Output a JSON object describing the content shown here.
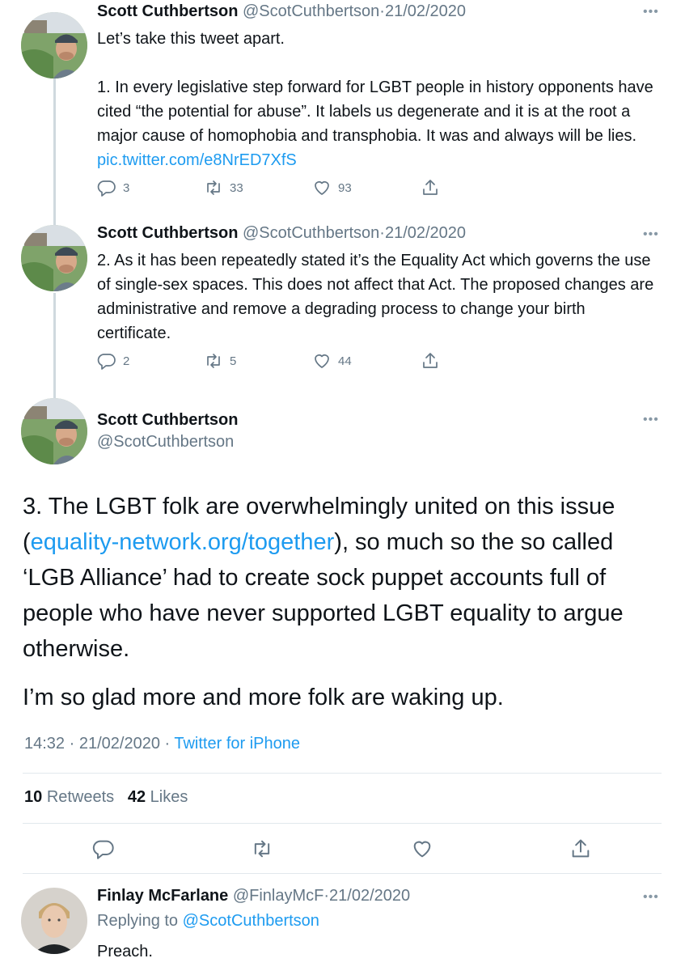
{
  "tweets": [
    {
      "name": "Scott Cuthbertson",
      "handle": "@ScotCuthbertson",
      "date": "21/02/2020",
      "text_intro": "Let’s take this tweet apart.",
      "text_body": "1. In every legislative step forward for LGBT people in history opponents have cited “the potential for abuse”. It labels us degenerate and it is at the root a major cause of homophobia and transphobia. It was and always will be lies.",
      "link": "pic.twitter.com/e8NrED7XfS",
      "replies": "3",
      "retweets": "33",
      "likes": "93"
    },
    {
      "name": "Scott Cuthbertson",
      "handle": "@ScotCuthbertson",
      "date": "21/02/2020",
      "text_body": "2. As it has been repeatedly stated it’s the Equality Act which governs the use of single-sex spaces. This does not affect that Act. The proposed changes are administrative and remove a degrading process to change your birth certificate.",
      "replies": "2",
      "retweets": "5",
      "likes": "44"
    }
  ],
  "main_tweet": {
    "name": "Scott Cuthbertson",
    "handle": "@ScotCuthbertson",
    "text_part1": "3. The LGBT folk are overwhelmingly united on this issue (",
    "link": "equality-network.org/together",
    "text_part2": "), so much so the so called ‘LGB Alliance’ had to create sock puppet accounts full of people who have never supported LGBT equality to argue otherwise.",
    "text_para2": "I’m so glad more and more folk are waking up.",
    "time": "14:32",
    "date": "21/02/2020",
    "source": "Twitter for iPhone",
    "retweet_count": "10",
    "retweet_label": "Retweets",
    "like_count": "42",
    "like_label": "Likes"
  },
  "reply": {
    "name": "Finlay McFarlane",
    "handle": "@FinlayMcF",
    "date": "21/02/2020",
    "replying_label": "Replying to",
    "replying_to": "@ScotCuthbertson",
    "text": "Preach."
  },
  "ui": {
    "more": "•••",
    "dot": "·"
  },
  "colors": {
    "link": "#1d9bf0",
    "muted": "#657786",
    "divider": "#e1e8ed"
  },
  "icons": [
    "reply-icon",
    "retweet-icon",
    "like-icon",
    "share-icon",
    "more-icon"
  ]
}
